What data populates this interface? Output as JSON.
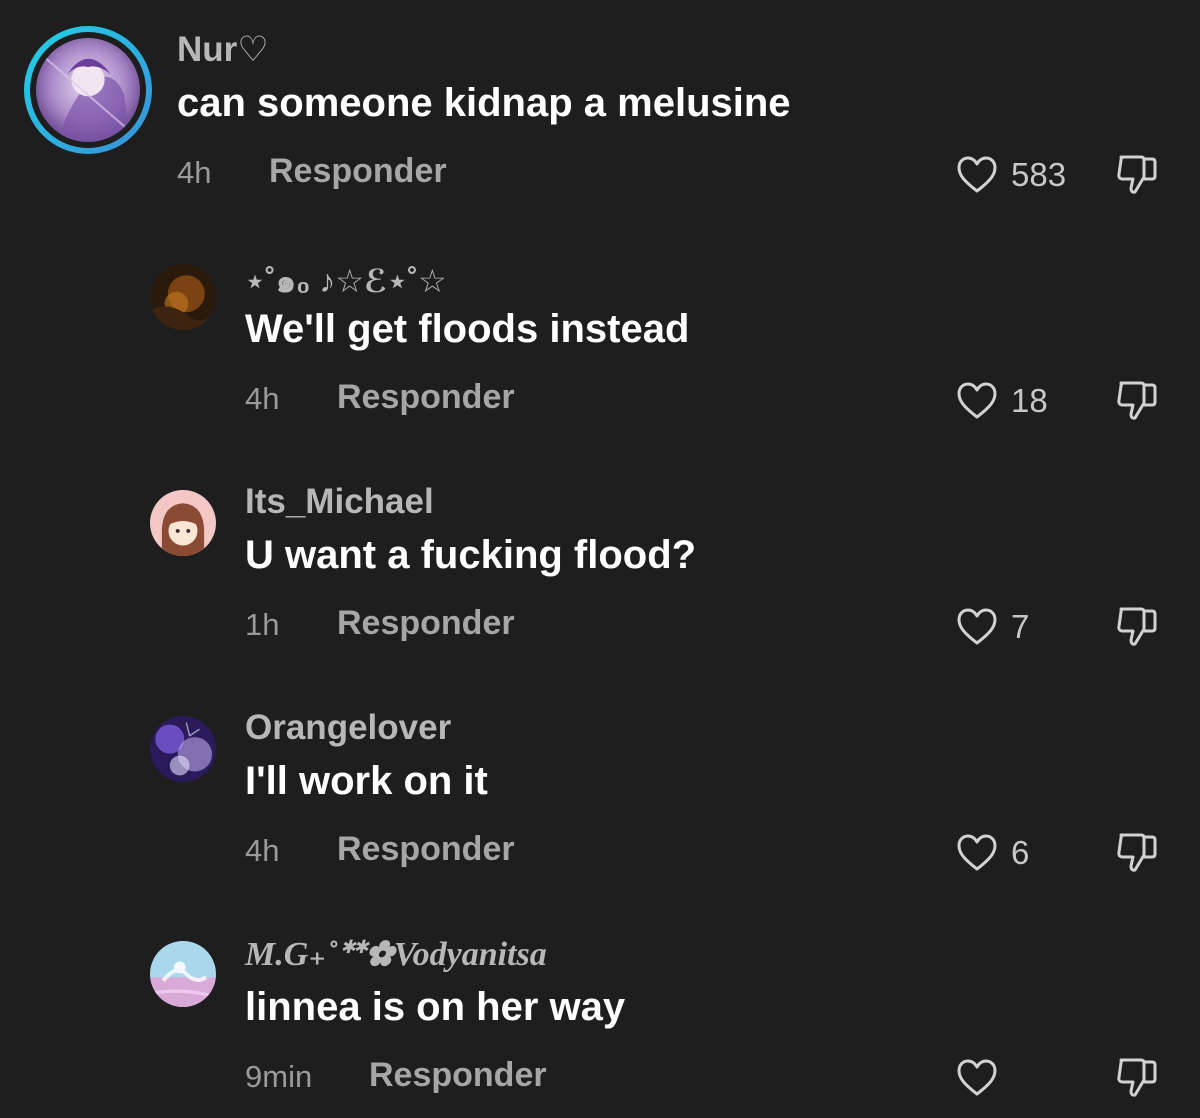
{
  "comments": [
    {
      "username": "Nur♡",
      "text": "can someone kidnap a melusine",
      "time": "4h",
      "reply_label": "Responder",
      "likes": "583"
    },
    {
      "username": "⋆˚๑₀ ♪☆ℰ⋆˚☆",
      "text": "We'll get floods instead",
      "time": "4h",
      "reply_label": "Responder",
      "likes": "18"
    },
    {
      "username": "Its_Michael",
      "text": "U want a fucking flood?",
      "time": "1h",
      "reply_label": "Responder",
      "likes": "7"
    },
    {
      "username": "Orangelover",
      "text": "I'll work on it",
      "time": "4h",
      "reply_label": "Responder",
      "likes": "6"
    },
    {
      "username": "M.G₊˚ᕯ✿Vodyanitsa",
      "text": "linnea is on her way",
      "time": "9min",
      "reply_label": "Responder",
      "likes": ""
    }
  ],
  "icons": {
    "like": "heart-outline-icon",
    "dislike": "thumbs-down-outline-icon"
  },
  "colors": {
    "background": "#1e1e1e",
    "story_ring_start": "#1fd3e6",
    "story_ring_end": "#3a8fd9"
  }
}
